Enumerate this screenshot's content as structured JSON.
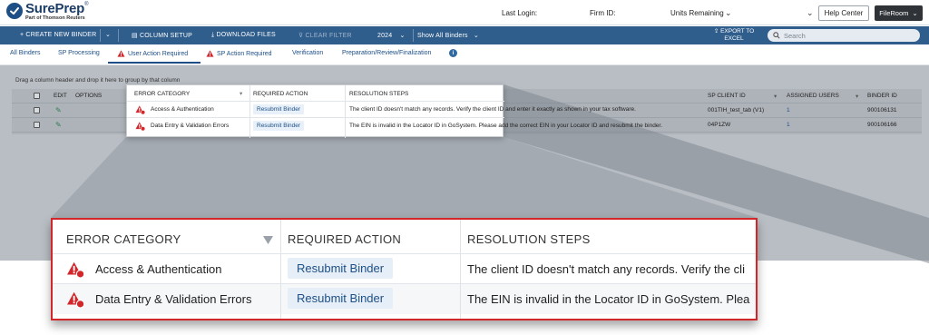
{
  "header": {
    "logo_name": "SurePrep",
    "logo_sub": "Part of Thomson Reuters",
    "last_login_label": "Last Login:",
    "firm_id_label": "Firm ID:",
    "units_remaining_label": "Units Remaining",
    "help_center_label": "Help Center",
    "fileroom_label": "FileRoom"
  },
  "toolbar": {
    "create_binder": "+ CREATE NEW BINDER",
    "column_setup": "COLUMN SETUP",
    "download_files": "DOWNLOAD FILES",
    "clear_filter": "CLEAR FILTER",
    "year": "2024",
    "show_binders": "Show All Binders",
    "export_excel": "EXPORT TO EXCEL",
    "search_placeholder": "Search"
  },
  "tabs": [
    {
      "label": "All Binders"
    },
    {
      "label": "SP Processing"
    },
    {
      "label": "User Action Required"
    },
    {
      "label": "SP Action Required"
    },
    {
      "label": "Verification"
    },
    {
      "label": "Preparation/Review/Finalization"
    }
  ],
  "grid": {
    "group_hint": "Drag a column header and drop it here to group by that column",
    "headers": {
      "edit": "EDIT",
      "options": "OPTIONS",
      "sp_client_id": "SP CLIENT ID",
      "assigned_users": "ASSIGNED USERS",
      "binder_id": "BINDER ID"
    },
    "rows": [
      {
        "sp_client_id": "001TIH_test_tab (V1)",
        "assigned_users": "1",
        "binder_id": "900106131"
      },
      {
        "sp_client_id": "04P1ZW",
        "assigned_users": "1",
        "binder_id": "900106166"
      }
    ]
  },
  "popup": {
    "headers": {
      "error_category": "ERROR CATEGORY",
      "required_action": "REQUIRED ACTION",
      "resolution_steps": "RESOLUTION STEPS"
    },
    "rows": [
      {
        "category": "Access & Authentication",
        "action": "Resubmit Binder",
        "steps": "The client ID doesn't match any records. Verify the client ID and enter it exactly as shown in your tax software."
      },
      {
        "category": "Data Entry & Validation Errors",
        "action": "Resubmit Binder",
        "steps": "The EIN is invalid in the Locator ID in GoSystem. Please add the correct EIN in your Locator ID and resubmit the binder."
      }
    ]
  },
  "zoom": {
    "rows": [
      {
        "steps": "The client ID doesn't match any records. Verify the cli"
      },
      {
        "steps": "The EIN is invalid in the Locator ID in GoSystem. Plea"
      }
    ]
  },
  "colors": {
    "brand_blue": "#1d4f86",
    "toolbar_bg": "#2f5d8c",
    "error_red": "#d3262b",
    "highlight_border": "#d3262b"
  }
}
